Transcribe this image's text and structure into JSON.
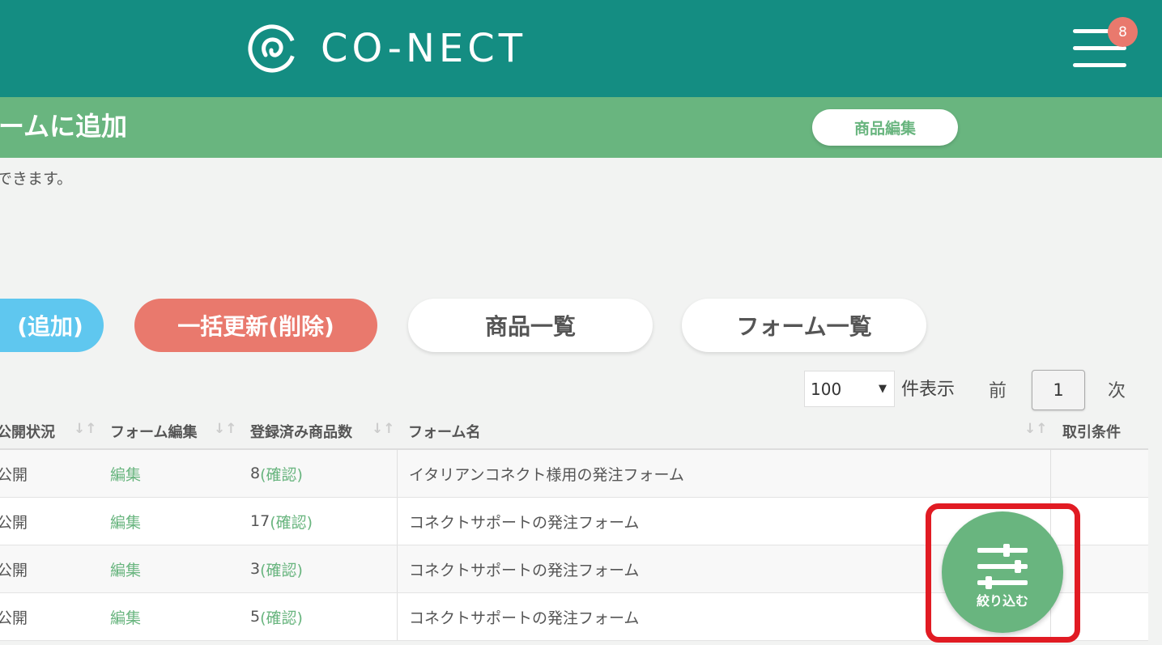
{
  "header": {
    "logo_text": "CO-NECT",
    "notification_count": "8",
    "colors": {
      "header_bg": "#148d82",
      "badge": "#e9796d"
    }
  },
  "subheader": {
    "title": "ームに追加",
    "edit_button": "商品編集"
  },
  "description": "できます。",
  "action_buttons": {
    "add": "(追加)",
    "bulk_delete": "一括更新(削除)",
    "product_list": "商品一覧",
    "form_list": "フォーム一覧"
  },
  "pagination": {
    "per_page_value": "100",
    "per_page_label": "件表示",
    "prev": "前",
    "page": "1",
    "next": "次"
  },
  "table": {
    "headers": [
      "公開状況",
      "フォーム編集",
      "登録済み商品数",
      "フォーム名",
      "取引条件"
    ],
    "rows": [
      {
        "status": "公開",
        "edit": "編集",
        "count": "8",
        "confirm": "(確認)",
        "name": "イタリアンコネクト様用の発注フォーム",
        "terms": ""
      },
      {
        "status": "公開",
        "edit": "編集",
        "count": "17",
        "confirm": "(確認)",
        "name": "コネクトサポートの発注フォーム",
        "terms": ""
      },
      {
        "status": "公開",
        "edit": "編集",
        "count": "3",
        "confirm": "(確認)",
        "name": "コネクトサポートの発注フォーム",
        "terms": ""
      },
      {
        "status": "公開",
        "edit": "編集",
        "count": "5",
        "confirm": "(確認)",
        "name": "コネクトサポートの発注フォーム",
        "terms": ""
      }
    ]
  },
  "filter_button": {
    "label": "絞り込む",
    "icon": "sliders-icon"
  }
}
